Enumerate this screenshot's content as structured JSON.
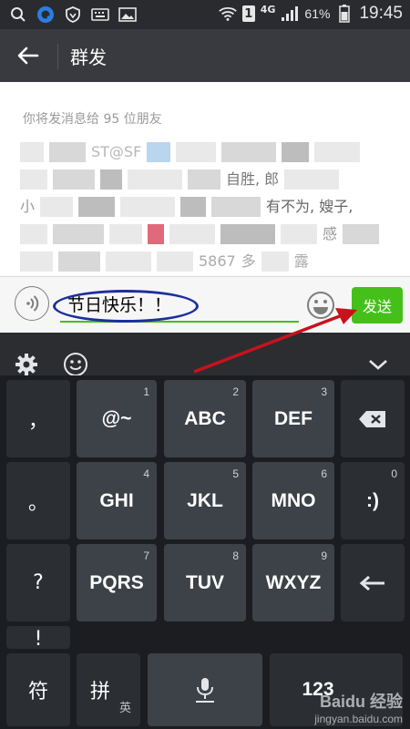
{
  "status_bar": {
    "battery_percent": "61%",
    "time": "19:45",
    "network": "4G",
    "sim": "1",
    "icons": [
      "search-icon",
      "browser-icon",
      "shield-icon",
      "keyboard-icon",
      "image-icon",
      "wifi-icon",
      "signal-icon",
      "battery-icon"
    ]
  },
  "header": {
    "title": "群发"
  },
  "content": {
    "recipients_text": "你将发消息给 95 位朋友",
    "blurred_fragments": [
      "ST@SF",
      "自胜, 郎",
      "小",
      "有不为, 嫂子,",
      "感",
      "5867",
      "多",
      "露"
    ]
  },
  "input": {
    "value": "节日快乐！！",
    "send_label": "发送"
  },
  "keyboard": {
    "rows": [
      [
        {
          "label": "，",
          "num": ""
        },
        {
          "label": "@~",
          "num": "1"
        },
        {
          "label": "ABC",
          "num": "2"
        },
        {
          "label": "DEF",
          "num": "3"
        },
        {
          "label": "backspace",
          "num": ""
        }
      ],
      [
        {
          "label": "。",
          "num": ""
        },
        {
          "label": "GHI",
          "num": "4"
        },
        {
          "label": "JKL",
          "num": "5"
        },
        {
          "label": "MNO",
          "num": "6"
        },
        {
          "label": ":)",
          "num": "0"
        }
      ],
      [
        {
          "label": "?",
          "num": ""
        },
        {
          "label": "PQRS",
          "num": "7"
        },
        {
          "label": "TUV",
          "num": "8"
        },
        {
          "label": "WXYZ",
          "num": "9"
        },
        {
          "label": "enter",
          "num": ""
        }
      ]
    ],
    "bottom": {
      "symbol": "符",
      "pinyin": "拼",
      "english": "英",
      "numbers": "123",
      "exclaim": "!"
    }
  },
  "watermark": {
    "main": "Baidu 经验",
    "sub": "jingyan.baidu.com"
  },
  "colors": {
    "send_green": "#45c01a",
    "header": "#393a3f",
    "annotation_blue": "#1b2f9c",
    "annotation_red": "#c8121c"
  }
}
